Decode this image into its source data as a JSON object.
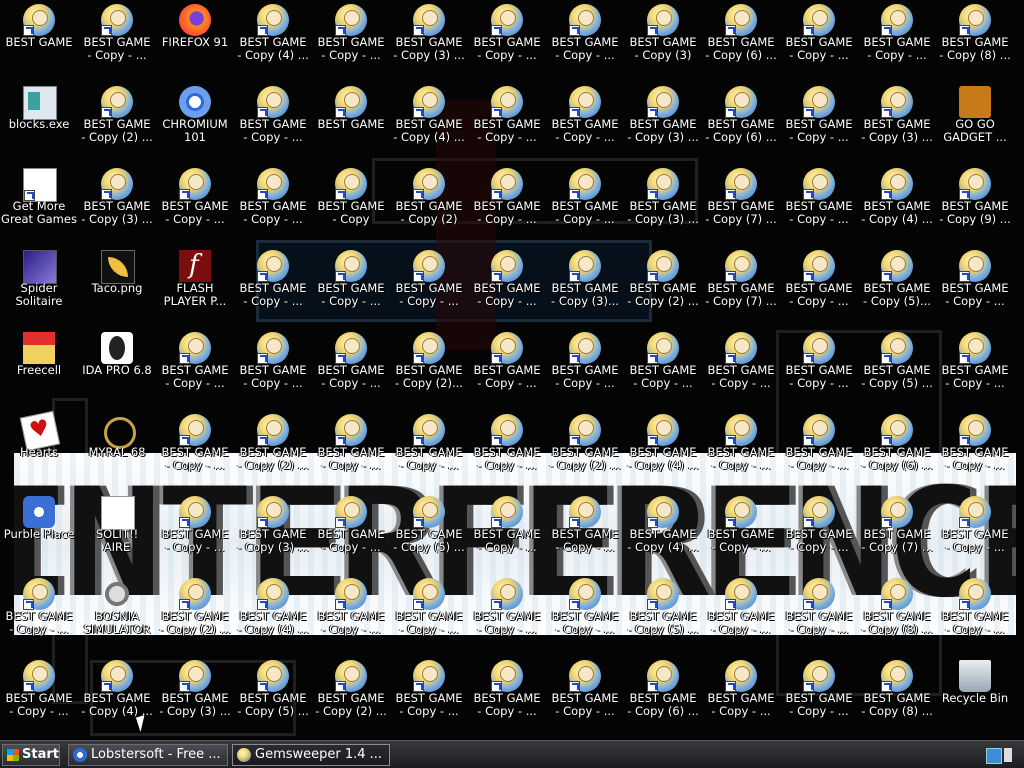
{
  "wallpaper": {
    "banner_text": "INTERFERENCE"
  },
  "desktop": {
    "icons": [
      {
        "label": "BEST GAME",
        "kind": "game",
        "col": 0,
        "row": 0
      },
      {
        "label": "BEST GAME\n- Copy - ...",
        "kind": "game",
        "col": 1,
        "row": 0
      },
      {
        "label": "FIREFOX 91",
        "kind": "firefox",
        "col": 2,
        "row": 0
      },
      {
        "label": "BEST GAME\n- Copy (4) ...",
        "kind": "game",
        "col": 3,
        "row": 0
      },
      {
        "label": "BEST GAME\n- Copy - ...",
        "kind": "game",
        "col": 4,
        "row": 0
      },
      {
        "label": "BEST GAME\n- Copy (3) ...",
        "kind": "game",
        "col": 5,
        "row": 0
      },
      {
        "label": "BEST GAME\n- Copy - ...",
        "kind": "game",
        "col": 6,
        "row": 0
      },
      {
        "label": "BEST GAME\n- Copy - ...",
        "kind": "game",
        "col": 7,
        "row": 0
      },
      {
        "label": "BEST GAME\n- Copy (3)",
        "kind": "game",
        "col": 8,
        "row": 0
      },
      {
        "label": "BEST GAME\n- Copy (6) ...",
        "kind": "game",
        "col": 9,
        "row": 0
      },
      {
        "label": "BEST GAME\n- Copy - ...",
        "kind": "game",
        "col": 10,
        "row": 0
      },
      {
        "label": "BEST GAME\n- Copy - ...",
        "kind": "game",
        "col": 11,
        "row": 0
      },
      {
        "label": "BEST GAME\n- Copy (8) ...",
        "kind": "game",
        "col": 12,
        "row": 0
      },
      {
        "label": "blocks.exe",
        "kind": "blocks",
        "col": 0,
        "row": 1
      },
      {
        "label": "BEST GAME\n- Copy (2) ...",
        "kind": "game",
        "col": 1,
        "row": 1
      },
      {
        "label": "CHROMIUM\n101",
        "kind": "chromium",
        "col": 2,
        "row": 1
      },
      {
        "label": "BEST GAME\n- Copy - ...",
        "kind": "game",
        "col": 3,
        "row": 1
      },
      {
        "label": "BEST GAME",
        "kind": "game",
        "col": 4,
        "row": 1
      },
      {
        "label": "BEST GAME\n- Copy (4) ...",
        "kind": "game",
        "col": 5,
        "row": 1
      },
      {
        "label": "BEST GAME\n- Copy - ...",
        "kind": "game",
        "col": 6,
        "row": 1
      },
      {
        "label": "BEST GAME\n- Copy - ...",
        "kind": "game",
        "col": 7,
        "row": 1
      },
      {
        "label": "BEST GAME\n- Copy (3) ...",
        "kind": "game",
        "col": 8,
        "row": 1
      },
      {
        "label": "BEST GAME\n- Copy (6) ...",
        "kind": "game",
        "col": 9,
        "row": 1
      },
      {
        "label": "BEST GAME\n- Copy - ...",
        "kind": "game",
        "col": 10,
        "row": 1
      },
      {
        "label": "BEST GAME\n- Copy (3) ...",
        "kind": "game",
        "col": 11,
        "row": 1
      },
      {
        "label": "GO GO\nGADGET ...",
        "kind": "briefcase",
        "col": 12,
        "row": 1
      },
      {
        "label": "Get More\nGreat Games",
        "kind": "doc",
        "col": 0,
        "row": 2
      },
      {
        "label": "BEST GAME\n- Copy (3) ...",
        "kind": "game",
        "col": 1,
        "row": 2
      },
      {
        "label": "BEST GAME\n- Copy - ...",
        "kind": "game",
        "col": 2,
        "row": 2
      },
      {
        "label": "BEST GAME\n- Copy - ...",
        "kind": "game",
        "col": 3,
        "row": 2
      },
      {
        "label": "BEST GAME\n- Copy",
        "kind": "game",
        "col": 4,
        "row": 2
      },
      {
        "label": "BEST GAME\n- Copy (2)",
        "kind": "game",
        "col": 5,
        "row": 2
      },
      {
        "label": "BEST GAME\n- Copy - ...",
        "kind": "game",
        "col": 6,
        "row": 2
      },
      {
        "label": "BEST GAME\n- Copy - ...",
        "kind": "game",
        "col": 7,
        "row": 2
      },
      {
        "label": "BEST GAME\n- Copy (3) ...",
        "kind": "game",
        "col": 8,
        "row": 2
      },
      {
        "label": "BEST GAME\n- Copy (7) ...",
        "kind": "game",
        "col": 9,
        "row": 2
      },
      {
        "label": "BEST GAME\n- Copy - ...",
        "kind": "game",
        "col": 10,
        "row": 2
      },
      {
        "label": "BEST GAME\n- Copy (4) ...",
        "kind": "game",
        "col": 11,
        "row": 2
      },
      {
        "label": "BEST GAME\n- Copy (9) ...",
        "kind": "game",
        "col": 12,
        "row": 2
      },
      {
        "label": "Spider\nSolitaire",
        "kind": "spider",
        "col": 0,
        "row": 3
      },
      {
        "label": "Taco.png",
        "kind": "taco",
        "col": 1,
        "row": 3
      },
      {
        "label": "FLASH\nPLAYER P...",
        "kind": "flash",
        "col": 2,
        "row": 3
      },
      {
        "label": "BEST GAME\n- Copy - ...",
        "kind": "game",
        "col": 3,
        "row": 3
      },
      {
        "label": "BEST GAME\n- Copy - ...",
        "kind": "game",
        "col": 4,
        "row": 3
      },
      {
        "label": "BEST GAME\n- Copy - ...",
        "kind": "game",
        "col": 5,
        "row": 3
      },
      {
        "label": "BEST GAME\n- Copy - ...",
        "kind": "game",
        "col": 6,
        "row": 3
      },
      {
        "label": "BEST GAME\n- Copy (3)...",
        "kind": "game",
        "col": 7,
        "row": 3
      },
      {
        "label": "BEST GAME\n- Copy (2) ...",
        "kind": "game",
        "col": 8,
        "row": 3
      },
      {
        "label": "BEST GAME\n- Copy (7) ...",
        "kind": "game",
        "col": 9,
        "row": 3
      },
      {
        "label": "BEST GAME\n- Copy - ...",
        "kind": "game",
        "col": 10,
        "row": 3
      },
      {
        "label": "BEST GAME\n- Copy (5)...",
        "kind": "game",
        "col": 11,
        "row": 3
      },
      {
        "label": "BEST GAME\n- Copy - ...",
        "kind": "game",
        "col": 12,
        "row": 3
      },
      {
        "label": "Freecell",
        "kind": "freecell",
        "col": 0,
        "row": 4
      },
      {
        "label": "IDA PRO 6.8",
        "kind": "ida",
        "col": 1,
        "row": 4
      },
      {
        "label": "BEST GAME\n- Copy - ...",
        "kind": "game",
        "col": 2,
        "row": 4
      },
      {
        "label": "BEST GAME\n- Copy - ...",
        "kind": "game",
        "col": 3,
        "row": 4
      },
      {
        "label": "BEST GAME\n- Copy - ...",
        "kind": "game",
        "col": 4,
        "row": 4
      },
      {
        "label": "BEST GAME\n- Copy (2)...",
        "kind": "game",
        "col": 5,
        "row": 4
      },
      {
        "label": "BEST GAME\n- Copy - ...",
        "kind": "game",
        "col": 6,
        "row": 4
      },
      {
        "label": "BEST GAME\n- Copy - ...",
        "kind": "game",
        "col": 7,
        "row": 4
      },
      {
        "label": "BEST GAME\n- Copy - ...",
        "kind": "game",
        "col": 8,
        "row": 4
      },
      {
        "label": "BEST GAME\n- Copy - ...",
        "kind": "game",
        "col": 9,
        "row": 4
      },
      {
        "label": "BEST GAME\n- Copy - ...",
        "kind": "game",
        "col": 10,
        "row": 4
      },
      {
        "label": "BEST GAME\n- Copy (5) ...",
        "kind": "game",
        "col": 11,
        "row": 4
      },
      {
        "label": "BEST GAME\n- Copy - ...",
        "kind": "game",
        "col": 12,
        "row": 4
      },
      {
        "label": "Hearts",
        "kind": "hearts",
        "col": 0,
        "row": 5
      },
      {
        "label": "MYRAL 68",
        "kind": "myral",
        "col": 1,
        "row": 5
      },
      {
        "label": "BEST GAME\n- Copy - ...",
        "kind": "game",
        "col": 2,
        "row": 5
      },
      {
        "label": "BEST GAME\n- Copy (2) ...",
        "kind": "game",
        "col": 3,
        "row": 5
      },
      {
        "label": "BEST GAME\n- Copy - ...",
        "kind": "game",
        "col": 4,
        "row": 5
      },
      {
        "label": "BEST GAME\n- Copy - ...",
        "kind": "game",
        "col": 5,
        "row": 5
      },
      {
        "label": "BEST GAME\n- Copy - ...",
        "kind": "game",
        "col": 6,
        "row": 5
      },
      {
        "label": "BEST GAME\n- Copy (2) ...",
        "kind": "game",
        "col": 7,
        "row": 5
      },
      {
        "label": "BEST GAME\n- Copy (4) ...",
        "kind": "game",
        "col": 8,
        "row": 5
      },
      {
        "label": "BEST GAME\n- Copy - ...",
        "kind": "game",
        "col": 9,
        "row": 5
      },
      {
        "label": "BEST GAME\n- Copy - ...",
        "kind": "game",
        "col": 10,
        "row": 5
      },
      {
        "label": "BEST GAME\n- Copy (6) ...",
        "kind": "game",
        "col": 11,
        "row": 5
      },
      {
        "label": "BEST GAME\n- Copy - ...",
        "kind": "game",
        "col": 12,
        "row": 5
      },
      {
        "label": "Purble Place",
        "kind": "purble",
        "col": 0,
        "row": 6
      },
      {
        "label": "SOLIT!!\nAIRE",
        "kind": "solit",
        "col": 1,
        "row": 6
      },
      {
        "label": "BEST GAME\n- Copy - ...",
        "kind": "game",
        "col": 2,
        "row": 6
      },
      {
        "label": "BEST GAME\n- Copy (3) ...",
        "kind": "game",
        "col": 3,
        "row": 6
      },
      {
        "label": "BEST GAME\n- Copy - ...",
        "kind": "game",
        "col": 4,
        "row": 6
      },
      {
        "label": "BEST GAME\n- Copy (5) ...",
        "kind": "game",
        "col": 5,
        "row": 6
      },
      {
        "label": "BEST GAME\n- Copy - ...",
        "kind": "game",
        "col": 6,
        "row": 6
      },
      {
        "label": "BEST GAME\n- Copy - ...",
        "kind": "game",
        "col": 7,
        "row": 6
      },
      {
        "label": "BEST GAME\n- Copy (4) ...",
        "kind": "game",
        "col": 8,
        "row": 6
      },
      {
        "label": "BEST GAME\n- Copy - ...",
        "kind": "game",
        "col": 9,
        "row": 6
      },
      {
        "label": "BEST GAME\n- Copy - ...",
        "kind": "game",
        "col": 10,
        "row": 6
      },
      {
        "label": "BEST GAME\n- Copy (7) ...",
        "kind": "game",
        "col": 11,
        "row": 6
      },
      {
        "label": "BEST GAME\n- Copy - ...",
        "kind": "game",
        "col": 12,
        "row": 6
      },
      {
        "label": "BEST GAME\n- Copy - ...",
        "kind": "game",
        "col": 0,
        "row": 7
      },
      {
        "label": "BOSNIA\nSIMULATOR",
        "kind": "bosnia",
        "col": 1,
        "row": 7
      },
      {
        "label": "BEST GAME\n- Copy (2) ...",
        "kind": "game",
        "col": 2,
        "row": 7
      },
      {
        "label": "BEST GAME\n- Copy (4) ...",
        "kind": "game",
        "col": 3,
        "row": 7
      },
      {
        "label": "BEST GAME\n- Copy - ...",
        "kind": "game",
        "col": 4,
        "row": 7
      },
      {
        "label": "BEST GAME\n- Copy - ...",
        "kind": "game",
        "col": 5,
        "row": 7
      },
      {
        "label": "BEST GAME\n- Copy - ...",
        "kind": "game",
        "col": 6,
        "row": 7
      },
      {
        "label": "BEST GAME\n- Copy - ...",
        "kind": "game",
        "col": 7,
        "row": 7
      },
      {
        "label": "BEST GAME\n- Copy (5) ...",
        "kind": "game",
        "col": 8,
        "row": 7
      },
      {
        "label": "BEST GAME\n- Copy - ...",
        "kind": "game",
        "col": 9,
        "row": 7
      },
      {
        "label": "BEST GAME\n- Copy - ...",
        "kind": "game",
        "col": 10,
        "row": 7
      },
      {
        "label": "BEST GAME\n- Copy (8) ...",
        "kind": "game",
        "col": 11,
        "row": 7
      },
      {
        "label": "BEST GAME\n- Copy - ...",
        "kind": "game",
        "col": 12,
        "row": 7
      },
      {
        "label": "BEST GAME\n- Copy - ...",
        "kind": "game",
        "col": 0,
        "row": 8
      },
      {
        "label": "BEST GAME\n- Copy (4) ...",
        "kind": "game",
        "col": 1,
        "row": 8
      },
      {
        "label": "BEST GAME\n- Copy (3) ...",
        "kind": "game",
        "col": 2,
        "row": 8
      },
      {
        "label": "BEST GAME\n- Copy (5) ...",
        "kind": "game",
        "col": 3,
        "row": 8
      },
      {
        "label": "BEST GAME\n- Copy (2) ...",
        "kind": "game",
        "col": 4,
        "row": 8
      },
      {
        "label": "BEST GAME\n- Copy - ...",
        "kind": "game",
        "col": 5,
        "row": 8
      },
      {
        "label": "BEST GAME\n- Copy - ...",
        "kind": "game",
        "col": 6,
        "row": 8
      },
      {
        "label": "BEST GAME\n- Copy - ...",
        "kind": "game",
        "col": 7,
        "row": 8
      },
      {
        "label": "BEST GAME\n- Copy (6) ...",
        "kind": "game",
        "col": 8,
        "row": 8
      },
      {
        "label": "BEST GAME\n- Copy - ...",
        "kind": "game",
        "col": 9,
        "row": 8
      },
      {
        "label": "BEST GAME\n- Copy - ...",
        "kind": "game",
        "col": 10,
        "row": 8
      },
      {
        "label": "BEST GAME\n- Copy (8) ...",
        "kind": "game",
        "col": 11,
        "row": 8
      },
      {
        "label": "Recycle Bin",
        "kind": "bin",
        "col": 12,
        "row": 8
      }
    ]
  },
  "taskbar": {
    "start_label": "Start",
    "tasks": [
      {
        "label": "Lobstersoft - Free ...",
        "icon": "chromium-icon"
      },
      {
        "label": "Gemsweeper 1.4 ...",
        "icon": "game-icon"
      }
    ]
  }
}
